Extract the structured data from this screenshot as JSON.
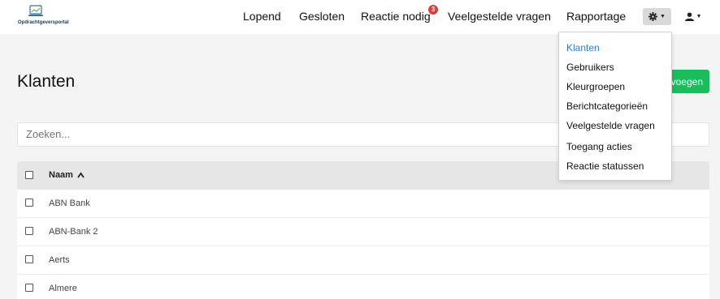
{
  "brand": {
    "name": "Opdrachtgeversportal",
    "icon": "laptop-icon"
  },
  "nav": {
    "items": [
      "Lopend",
      "Gesloten",
      "Reactie nodig",
      "Veelgestelde vragen",
      "Rapportage"
    ],
    "badge_count": "3",
    "settings_icon": "gear-icon",
    "user_icon": "user-icon"
  },
  "page": {
    "title": "Klanten",
    "add_button": "Toevoegen",
    "search_placeholder": "Zoeken..."
  },
  "table": {
    "header": "Naam",
    "rows": [
      "ABN Bank",
      "ABN-Bank 2",
      "Aerts",
      "Almere"
    ]
  },
  "dropdown": {
    "items": [
      "Klanten",
      "Gebruikers",
      "Kleurgroepen",
      "Berichtcategorieën",
      "Veelgestelde vragen",
      "Toegang acties",
      "Reactie statussen"
    ],
    "active": "Klanten"
  },
  "colors": {
    "accent": "#1abc5c",
    "badge": "#e03b3b",
    "link_active": "#2b7de0"
  }
}
